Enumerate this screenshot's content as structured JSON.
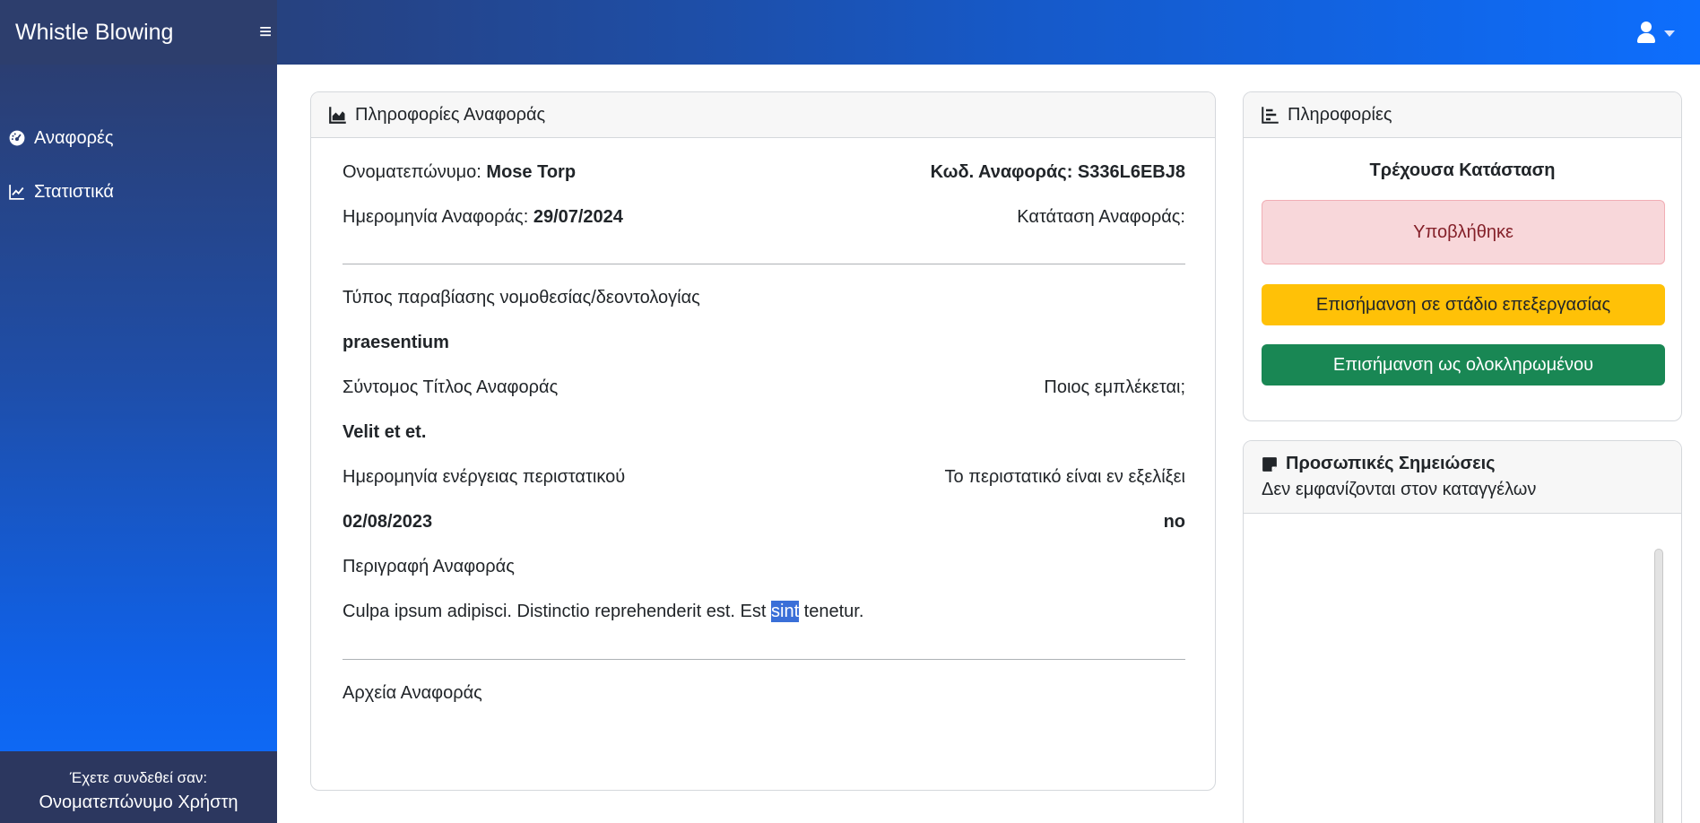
{
  "app": {
    "brand": "Whistle Blowing"
  },
  "sidebar": {
    "items": [
      {
        "label": "Αναφορές",
        "icon": "gauge-icon"
      },
      {
        "label": "Στατιστικά",
        "icon": "chart-line-icon"
      }
    ],
    "footer": {
      "logged_in_label": "Έχετε συνδεθεί σαν:",
      "username": "Ονοματεπώνυμο Χρήστη"
    }
  },
  "report": {
    "header": "Πληροφορίες Αναφοράς",
    "name_label": "Ονοματεπώνυμο:",
    "name_value": "Mose Torp",
    "code_label": "Κωδ. Αναφοράς:",
    "code_value": "S336L6EBJ8",
    "date_label": "Ημερομηνία Αναφοράς:",
    "date_value": "29/07/2024",
    "status_label": "Κατάταση Αναφοράς:",
    "violation_label": "Τύπος παραβίασης νομοθεσίας/δεοντολογίας",
    "violation_value": "praesentium",
    "short_title_label": "Σύντομος Τίτλος Αναφοράς",
    "involved_label": "Ποιος εμπλέκεται;",
    "short_title_value": "Velit et et.",
    "incident_date_label": "Ημερομηνία ενέργειας περιστατικού",
    "ongoing_label": "Το περιστατικό είναι εν εξελίξει",
    "incident_date_value": "02/08/2023",
    "ongoing_value": "no",
    "description_label": "Περιγραφή Αναφοράς",
    "description_before": "Culpa ipsum adipisci. Distinctio reprehenderit est. Est ",
    "description_selected": "sint",
    "description_after": " tenetur.",
    "files_label": "Αρχεία Αναφοράς"
  },
  "info": {
    "header": "Πληροφορίες",
    "current_status_title": "Τρέχουσα Κατάσταση",
    "status": "Υποβλήθηκε",
    "mark_processing": "Επισήμανση σε στάδιο επεξεργασίας",
    "mark_completed": "Επισήμανση ως ολοκληρωμένου"
  },
  "notes": {
    "title": "Προσωπικές Σημειώσεις",
    "subtitle": "Δεν εμφανίζονται στον καταγγέλων"
  },
  "colors": {
    "warning": "#ffc107",
    "success": "#198754",
    "danger_bg": "#f8d7da",
    "primary": "#0d6efd"
  }
}
